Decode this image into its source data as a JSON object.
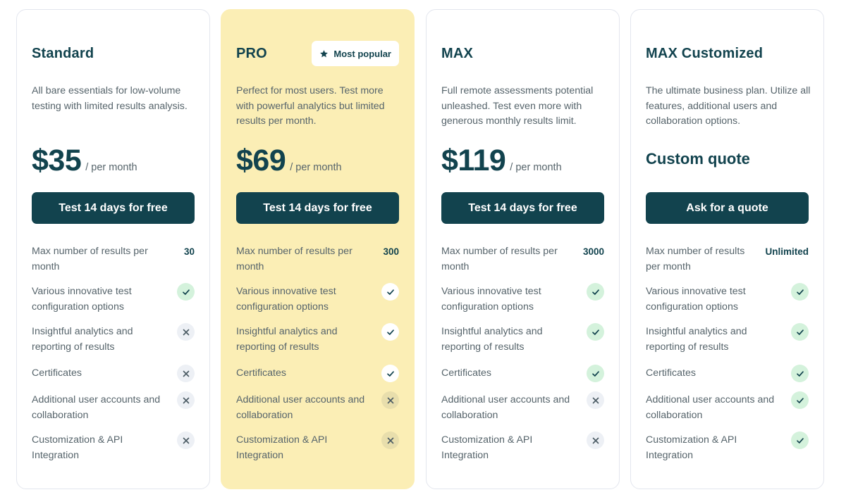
{
  "colors": {
    "primary": "#12434e",
    "featured_bg": "#fbeeb5",
    "check_bg": "#d4f2dc",
    "cross_bg": "#edf0f5",
    "text_muted": "#56646b"
  },
  "plans": [
    {
      "name": "Standard",
      "description": "All bare essentials for low-volume testing with limited results analysis.",
      "price": "$35",
      "period": "/ per month",
      "cta": "Test 14 days for free",
      "features": [
        {
          "label": "Max number of results per month",
          "value": "30"
        },
        {
          "label": "Various innovative test configuration options",
          "included": true,
          "icon": "check-icon"
        },
        {
          "label": "Insightful analytics and reporting of results",
          "included": false,
          "icon": "close-icon"
        },
        {
          "label": "Certificates",
          "included": false,
          "icon": "close-icon"
        },
        {
          "label": "Additional user accounts and collaboration",
          "included": false,
          "icon": "close-icon"
        },
        {
          "label": "Customization & API Integration",
          "included": false,
          "icon": "close-icon"
        }
      ]
    },
    {
      "name": "PRO",
      "badge": {
        "icon": "star-icon",
        "label": "Most popular"
      },
      "description": "Perfect for most users. Test more with powerful analytics but limited results per month.",
      "price": "$69",
      "period": "/ per month",
      "cta": "Test 14 days for free",
      "features": [
        {
          "label": "Max number of results per month",
          "value": "300"
        },
        {
          "label": "Various innovative test configuration options",
          "included": true,
          "icon": "check-icon"
        },
        {
          "label": "Insightful analytics and reporting of results",
          "included": true,
          "icon": "check-icon"
        },
        {
          "label": "Certificates",
          "included": true,
          "icon": "check-icon"
        },
        {
          "label": "Additional user accounts and collaboration",
          "included": false,
          "icon": "close-icon"
        },
        {
          "label": "Customization & API Integration",
          "included": false,
          "icon": "close-icon"
        }
      ]
    },
    {
      "name": "MAX",
      "description": "Full remote assessments potential unleashed. Test even more with generous monthly results limit.",
      "price": "$119",
      "period": "/ per month",
      "cta": "Test 14 days for free",
      "features": [
        {
          "label": "Max number of results per month",
          "value": "3000"
        },
        {
          "label": "Various innovative test configuration options",
          "included": true,
          "icon": "check-icon"
        },
        {
          "label": "Insightful analytics and reporting of results",
          "included": true,
          "icon": "check-icon"
        },
        {
          "label": "Certificates",
          "included": true,
          "icon": "check-icon"
        },
        {
          "label": "Additional user accounts and collaboration",
          "included": false,
          "icon": "close-icon"
        },
        {
          "label": "Customization & API Integration",
          "included": false,
          "icon": "close-icon"
        }
      ]
    },
    {
      "name": "MAX Customized",
      "description": "The ultimate business plan. Utilize all features, additional users and collaboration options.",
      "price_text": "Custom quote",
      "cta": "Ask for a quote",
      "features": [
        {
          "label": "Max number of results per month",
          "value": "Unlimited"
        },
        {
          "label": "Various innovative test configuration options",
          "included": true,
          "icon": "check-icon"
        },
        {
          "label": "Insightful analytics and reporting of results",
          "included": true,
          "icon": "check-icon"
        },
        {
          "label": "Certificates",
          "included": true,
          "icon": "check-icon"
        },
        {
          "label": "Additional user accounts and collaboration",
          "included": true,
          "icon": "check-icon"
        },
        {
          "label": "Customization & API Integration",
          "included": true,
          "icon": "check-icon"
        }
      ]
    }
  ]
}
